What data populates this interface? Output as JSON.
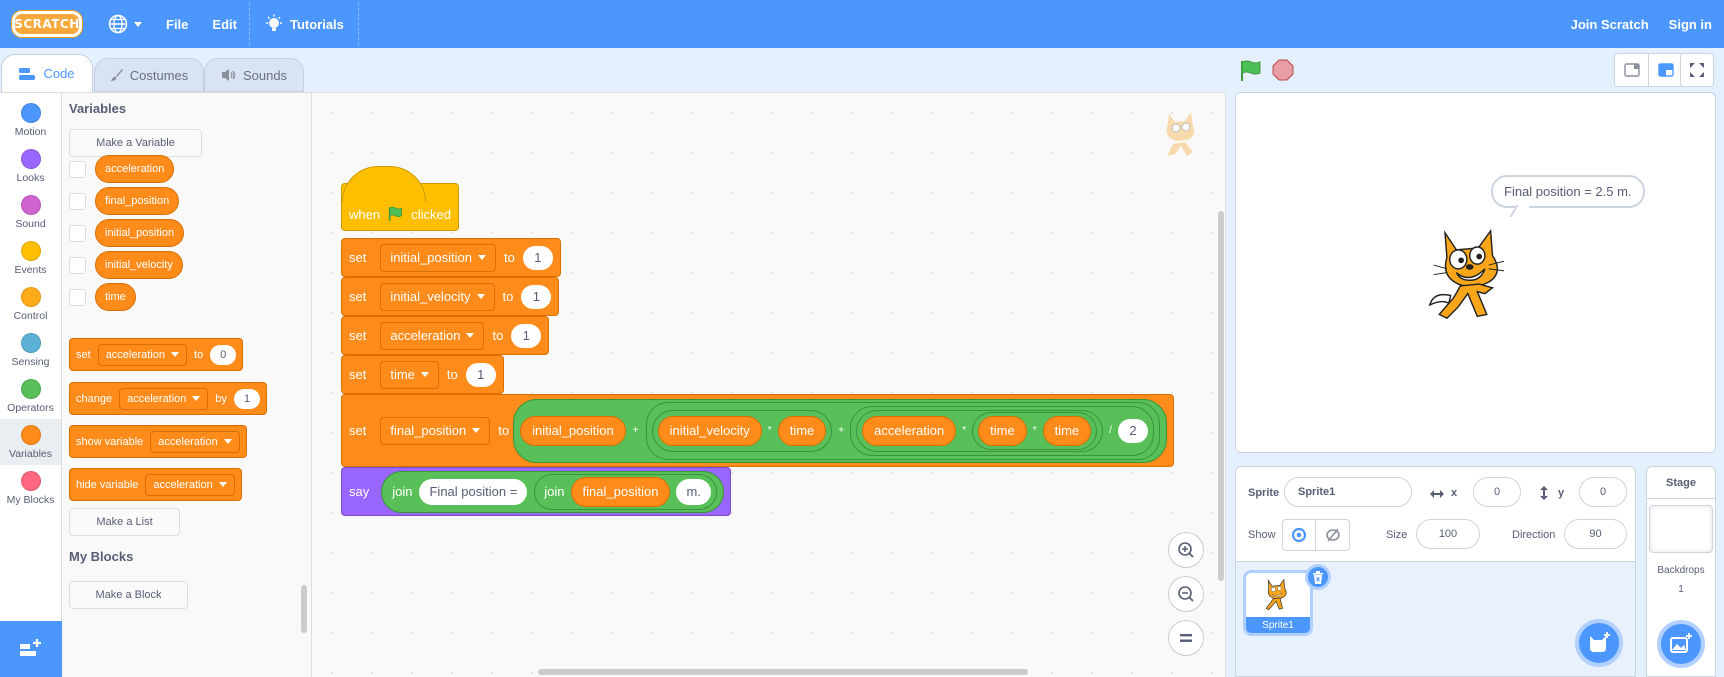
{
  "menubar": {
    "logo": "SCRATCH",
    "file": "File",
    "edit": "Edit",
    "tutorials": "Tutorials",
    "join": "Join Scratch",
    "signin": "Sign in"
  },
  "tabs": [
    {
      "label": "Code",
      "icon": "code-icon",
      "active": true
    },
    {
      "label": "Costumes",
      "icon": "brush-icon",
      "active": false
    },
    {
      "label": "Sounds",
      "icon": "speaker-icon",
      "active": false
    }
  ],
  "categories": [
    {
      "label": "Motion",
      "color": "#4c97ff"
    },
    {
      "label": "Looks",
      "color": "#9966ff"
    },
    {
      "label": "Sound",
      "color": "#cf63cf"
    },
    {
      "label": "Events",
      "color": "#ffbf00"
    },
    {
      "label": "Control",
      "color": "#ffab19"
    },
    {
      "label": "Sensing",
      "color": "#5cb1d6"
    },
    {
      "label": "Operators",
      "color": "#59c059"
    },
    {
      "label": "Variables",
      "color": "#ff8c1a"
    },
    {
      "label": "My Blocks",
      "color": "#ff6680"
    }
  ],
  "palette": {
    "variables_heading": "Variables",
    "make_variable": "Make a Variable",
    "variables": [
      "acceleration",
      "final_position",
      "initial_position",
      "initial_velocity",
      "time"
    ],
    "blocks": {
      "set": {
        "label": "set",
        "var": "acceleration",
        "to": "to",
        "value": "0"
      },
      "change": {
        "label": "change",
        "var": "acceleration",
        "by": "by",
        "value": "1"
      },
      "show": {
        "label": "show variable",
        "var": "acceleration"
      },
      "hide": {
        "label": "hide variable",
        "var": "acceleration"
      }
    },
    "make_list": "Make a List",
    "myblocks_heading": "My Blocks",
    "make_block": "Make a Block"
  },
  "script": {
    "hat": {
      "when": "when",
      "clicked": "clicked"
    },
    "sets": [
      {
        "label": "set",
        "var": "initial_position",
        "to": "to",
        "value": "1"
      },
      {
        "label": "set",
        "var": "initial_velocity",
        "to": "to",
        "value": "1"
      },
      {
        "label": "set",
        "var": "acceleration",
        "to": "to",
        "value": "1"
      },
      {
        "label": "set",
        "var": "time",
        "to": "to",
        "value": "1"
      }
    ],
    "final": {
      "label": "set",
      "var": "final_position",
      "to": "to",
      "expr": {
        "v1": "initial_position",
        "plus1": "+",
        "v2": "initial_velocity",
        "times1": "*",
        "v3": "time",
        "plus2": "+",
        "v4": "acceleration",
        "times2": "*",
        "v5": "time",
        "times3": "*",
        "v6": "time",
        "div": "/",
        "divisor": "2"
      }
    },
    "say": {
      "label": "say",
      "join1": "join",
      "text1": "Final position =",
      "join2": "join",
      "var": "final_position",
      "text2": "m."
    }
  },
  "stage": {
    "bubble": "Final position = 2.5 m."
  },
  "sprite_info": {
    "sprite_label": "Sprite",
    "sprite_name": "Sprite1",
    "x_label": "x",
    "x": "0",
    "y_label": "y",
    "y": "0",
    "show_label": "Show",
    "size_label": "Size",
    "size": "100",
    "direction_label": "Direction",
    "direction": "90"
  },
  "sprites": [
    {
      "name": "Sprite1",
      "selected": true
    }
  ],
  "stage_pane": {
    "title": "Stage",
    "backdrops_label": "Backdrops",
    "backdrops_count": "1"
  }
}
